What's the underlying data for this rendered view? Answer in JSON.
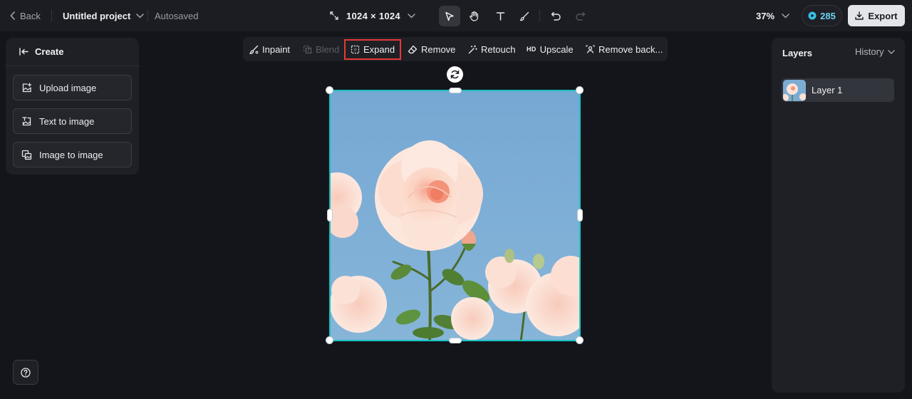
{
  "topbar": {
    "back_label": "Back",
    "project_name": "Untitled project",
    "autosave_status": "Autosaved",
    "canvas_size": "1024 × 1024",
    "zoom": "37%",
    "credits": "285",
    "export_label": "Export"
  },
  "tools": [
    {
      "name": "select",
      "icon": "pointer-icon",
      "active": true
    },
    {
      "name": "hand",
      "icon": "hand-icon",
      "active": false
    },
    {
      "name": "text",
      "icon": "text-icon",
      "active": false
    },
    {
      "name": "brush",
      "icon": "brush-icon",
      "active": false
    },
    {
      "name": "undo",
      "icon": "undo-icon",
      "active": false
    },
    {
      "name": "redo",
      "icon": "redo-icon",
      "active": false
    }
  ],
  "left_panel": {
    "title": "Create",
    "buttons": [
      {
        "label": "Upload image",
        "icon": "upload-image-icon"
      },
      {
        "label": "Text to image",
        "icon": "text-to-image-icon"
      },
      {
        "label": "Image to image",
        "icon": "image-to-image-icon"
      }
    ]
  },
  "context_toolbar": {
    "items": [
      {
        "label": "Inpaint",
        "icon": "inpaint-icon",
        "enabled": true
      },
      {
        "label": "Blend",
        "icon": "blend-icon",
        "enabled": false
      },
      {
        "label": "Expand",
        "icon": "expand-icon",
        "enabled": true,
        "highlighted": true
      },
      {
        "label": "Remove",
        "icon": "eraser-icon",
        "enabled": true
      },
      {
        "label": "Retouch",
        "icon": "magic-wand-icon",
        "enabled": true
      },
      {
        "label": "Upscale",
        "icon": "hd-icon",
        "icon_text": "HD",
        "enabled": true
      },
      {
        "label": "Remove back...",
        "icon": "remove-background-icon",
        "enabled": true
      }
    ]
  },
  "right_panel": {
    "title": "Layers",
    "history_label": "History",
    "layers": [
      {
        "name": "Layer 1",
        "selected": true
      }
    ]
  },
  "colors": {
    "accent_selection": "#19c2c4",
    "highlight_box": "#e53935",
    "credits_text": "#6ad3ee",
    "background": "#14151a",
    "panel": "#1f2025"
  }
}
